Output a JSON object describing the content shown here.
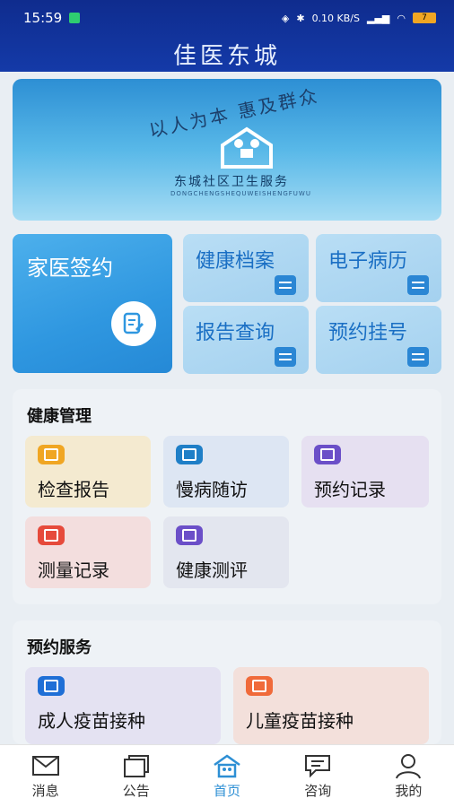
{
  "status": {
    "time": "15:59",
    "network": "0.10 KB/S",
    "battery": "7"
  },
  "app": {
    "title": "佳医东城"
  },
  "banner": {
    "slogan": "以人为本 惠及群众",
    "org": "东城社区卫生服务",
    "pinyin": "DONGCHENGSHEQUWEISHENGFUWU"
  },
  "quick": {
    "big": {
      "label": "家医签约"
    },
    "tiles": [
      {
        "label": "健康档案"
      },
      {
        "label": "电子病历"
      },
      {
        "label": "报告查询"
      },
      {
        "label": "预约挂号"
      }
    ]
  },
  "health": {
    "title": "健康管理",
    "items": [
      {
        "label": "检查报告",
        "color": "#f0a623"
      },
      {
        "label": "慢病随访",
        "color": "#1f7fc7"
      },
      {
        "label": "预约记录",
        "color": "#6b4fc8"
      },
      {
        "label": "测量记录",
        "color": "#e64a3b"
      },
      {
        "label": "健康测评",
        "color": "#6b4fc8"
      }
    ]
  },
  "booking": {
    "title": "预约服务",
    "items": [
      {
        "label": "成人疫苗接种",
        "color": "#1f6fd6"
      },
      {
        "label": "儿童疫苗接种",
        "color": "#f06a3a"
      }
    ]
  },
  "nav": {
    "items": [
      {
        "label": "消息",
        "icon": "mail-icon"
      },
      {
        "label": "公告",
        "icon": "notice-icon"
      },
      {
        "label": "首页",
        "icon": "home-icon"
      },
      {
        "label": "咨询",
        "icon": "chat-icon"
      },
      {
        "label": "我的",
        "icon": "user-icon"
      }
    ],
    "active": "首页"
  }
}
